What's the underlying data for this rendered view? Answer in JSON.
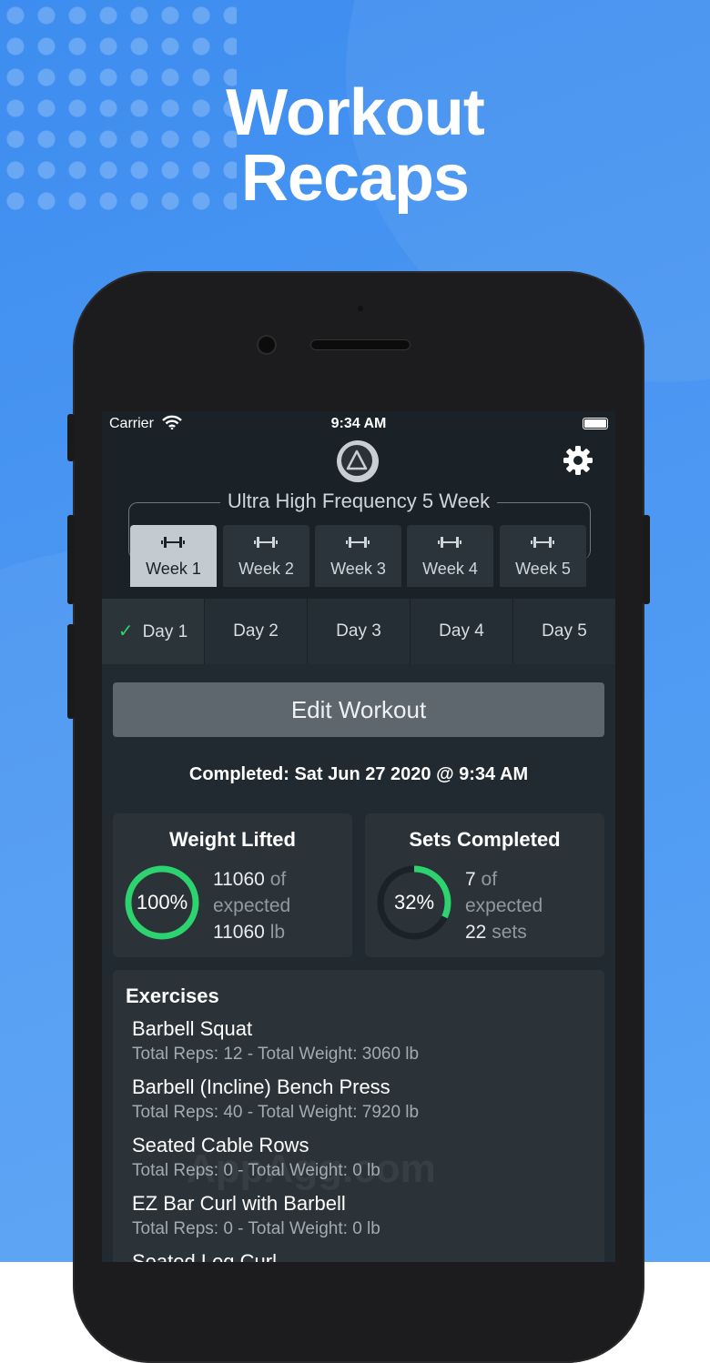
{
  "headline": {
    "line1": "Workout",
    "line2": "Recaps"
  },
  "status_bar": {
    "carrier": "Carrier",
    "time": "9:34 AM"
  },
  "program": {
    "title": "Ultra High Frequency 5 Week"
  },
  "weeks": [
    {
      "label": "Week 1",
      "active": true
    },
    {
      "label": "Week 2"
    },
    {
      "label": "Week 3"
    },
    {
      "label": "Week 4"
    },
    {
      "label": "Week 5"
    }
  ],
  "days": [
    {
      "label": "Day 1",
      "completed": true
    },
    {
      "label": "Day 2"
    },
    {
      "label": "Day 3"
    },
    {
      "label": "Day 4"
    },
    {
      "label": "Day 5"
    }
  ],
  "edit_button": "Edit Workout",
  "completed_text": "Completed: Sat Jun 27 2020 @ 9:34 AM",
  "weight_lifted": {
    "title": "Weight Lifted",
    "percent_label": "100%",
    "percent": 1.0,
    "value": "11060",
    "of": "of",
    "expected": "expected",
    "expected_value": "11060",
    "unit": "lb"
  },
  "sets_completed": {
    "title": "Sets Completed",
    "percent_label": "32%",
    "percent": 0.32,
    "value": "7",
    "of": "of",
    "expected": "expected",
    "expected_value": "22",
    "unit": "sets"
  },
  "exercises": {
    "title": "Exercises",
    "items": [
      {
        "name": "Barbell Squat",
        "detail": "Total Reps: 12  -  Total Weight: 3060 lb"
      },
      {
        "name": "Barbell (Incline) Bench Press",
        "detail": "Total Reps: 40  -  Total Weight: 7920 lb"
      },
      {
        "name": "Seated Cable Rows",
        "detail": "Total Reps: 0  -  Total Weight: 0 lb"
      },
      {
        "name": "EZ Bar Curl with Barbell",
        "detail": "Total Reps: 0  -  Total Weight: 0 lb"
      },
      {
        "name": "Seated Leg Curl",
        "detail": ""
      }
    ]
  },
  "watermark": "AppAgg.com",
  "colors": {
    "accent_green": "#2dd36f",
    "background_blue": "#4b97f2",
    "screen_bg": "#212a30"
  }
}
